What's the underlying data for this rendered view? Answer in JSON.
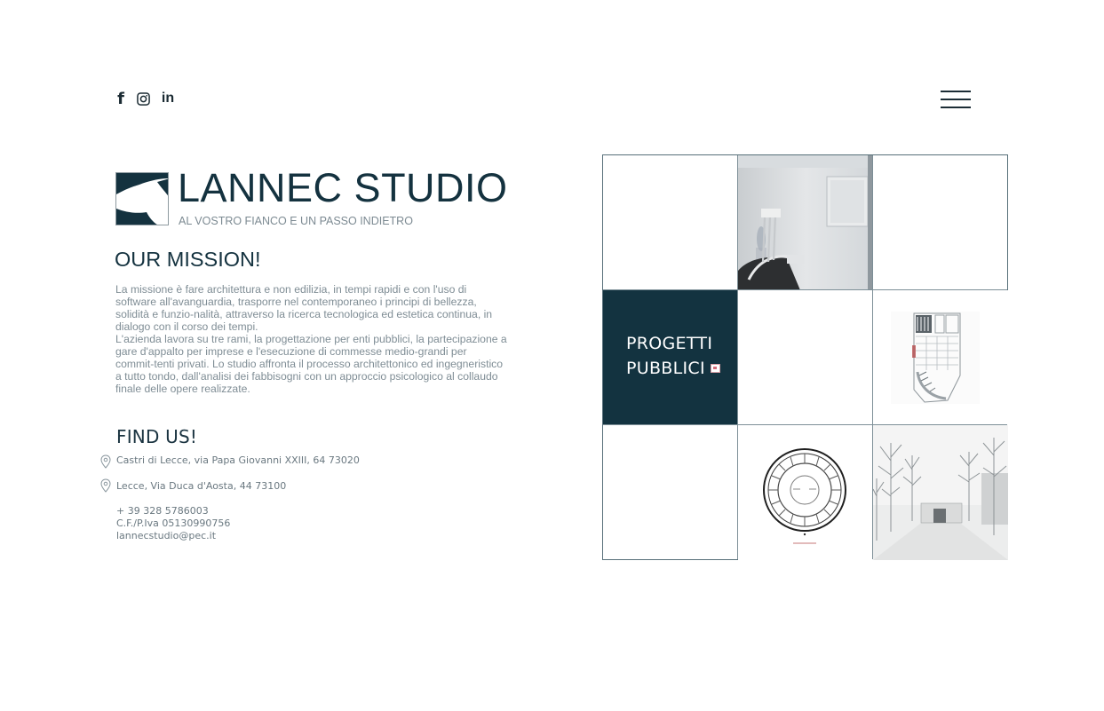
{
  "social": {
    "icons": [
      "facebook-icon",
      "instagram-icon",
      "linkedin-icon"
    ],
    "facebook_glyph": "f",
    "linkedin_glyph": "in"
  },
  "menu": {
    "icon": "hamburger-menu-icon"
  },
  "brand": {
    "title": "LANNEC STUDIO",
    "tagline": "AL VOSTRO FIANCO E UN PASSO INDIETRO"
  },
  "mission": {
    "title": "OUR MISSION!",
    "paragraphs": [
      "La missione è fare architettura e non edilizia, in tempi rapidi e con l'uso di software all'avanguardia, trasporre nel contemporaneo i principi di bellezza, solidità e funzio-nalità, attraverso la ricerca tecnologica ed estetica continua, in dialogo con il corso dei tempi.",
      "L'azienda lavora su tre rami, la progettazione per enti pubblici, la partecipazione a gare d'appalto per imprese e l'esecuzione di commesse medio-grandi per commit-tenti privati. Lo studio affronta il processo architettonico ed ingegneristico a tutto tondo, dall'analisi dei fabbisogni con un approccio psicologico al collaudo finale delle opere realizzate."
    ]
  },
  "find_us": {
    "title": "FIND US!",
    "addresses": [
      "Castri di Lecce, via Papa Giovanni XXIII, 64 73020",
      "Lecce, Via Duca d'Aosta, 44 73100"
    ],
    "phone": "+ 39 328 5786003",
    "vat": "C.F./P.Iva 05130990756",
    "email": "lannecstudio@pec.it"
  },
  "gallery": {
    "featured_label_line1": "PROGETTI",
    "featured_label_line2": "PUBBLICI",
    "tiles": [
      "empty",
      "dental-clinic-photo",
      "empty",
      "progetti-pubblici",
      "empty",
      "floor-plan-drawing",
      "empty",
      "circular-plan-drawing",
      "tree-avenue-render"
    ]
  },
  "colors": {
    "brand_dark": "#133340",
    "text_grey": "#7f8d95",
    "grid_line": "#7d8f97"
  }
}
